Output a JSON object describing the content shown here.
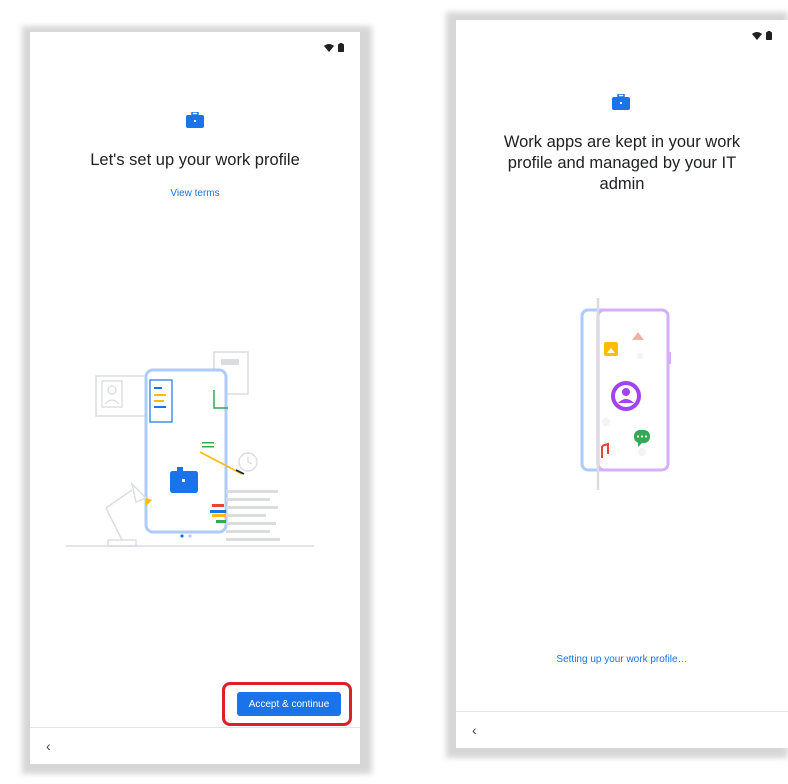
{
  "left_screen": {
    "title": "Let's set up your work profile",
    "view_terms_label": "View terms",
    "accept_button_label": "Accept & continue",
    "back_glyph": "‹",
    "icons": [
      "wifi-icon",
      "battery-icon",
      "briefcase-icon",
      "back-icon"
    ]
  },
  "right_screen": {
    "title": "Work apps are kept in your work profile and managed by your IT admin",
    "status_text": "Setting up your work profile…",
    "back_glyph": "‹",
    "icons": [
      "wifi-icon",
      "battery-icon",
      "briefcase-icon",
      "back-icon"
    ]
  },
  "colors": {
    "accent": "#1a73e8",
    "highlight": "#e11d2a",
    "purple": "#a142f4",
    "yellow": "#fbbc04",
    "green": "#34a853",
    "red": "#ea4335"
  }
}
